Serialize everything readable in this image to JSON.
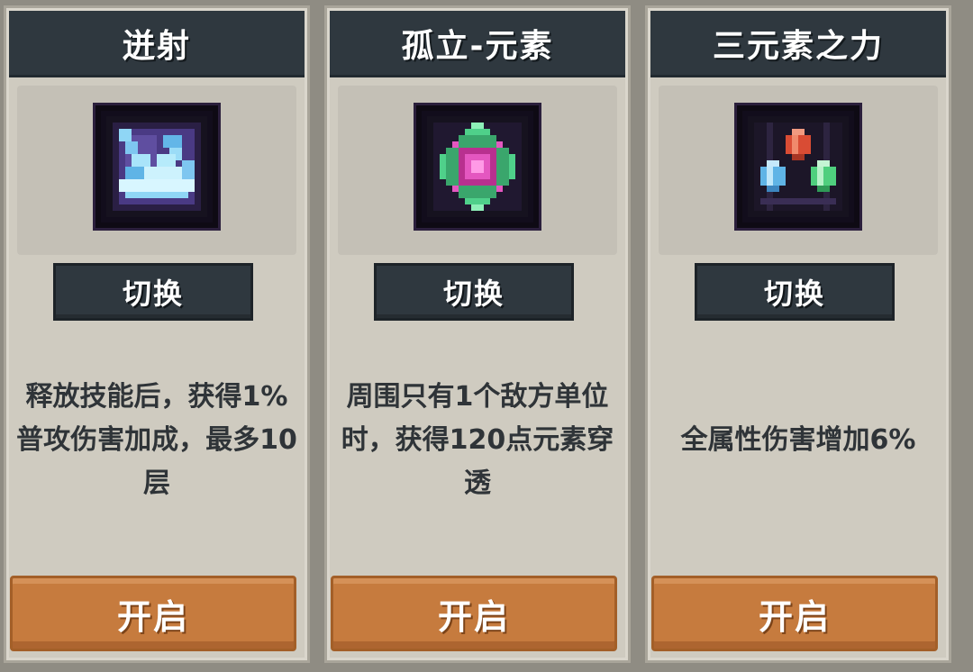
{
  "cards": [
    {
      "title": "迸射",
      "icon": "shard-burst-icon",
      "switch_label": "切换",
      "description": "释放技能后，获得1%普攻伤害加成，最多10层",
      "open_label": "开启"
    },
    {
      "title": "孤立-元素",
      "icon": "element-core-icon",
      "switch_label": "切换",
      "description": "周围只有1个敌方单位时，获得120点元素穿透",
      "open_label": "开启"
    },
    {
      "title": "三元素之力",
      "icon": "three-crystals-icon",
      "switch_label": "切换",
      "description": "全属性伤害增加6%",
      "open_label": "开启"
    }
  ],
  "colors": {
    "header_bg": "#2f383f",
    "card_bg": "#cfcbc0",
    "open_button": "#c67b3e",
    "text_dark": "#2f3438"
  }
}
